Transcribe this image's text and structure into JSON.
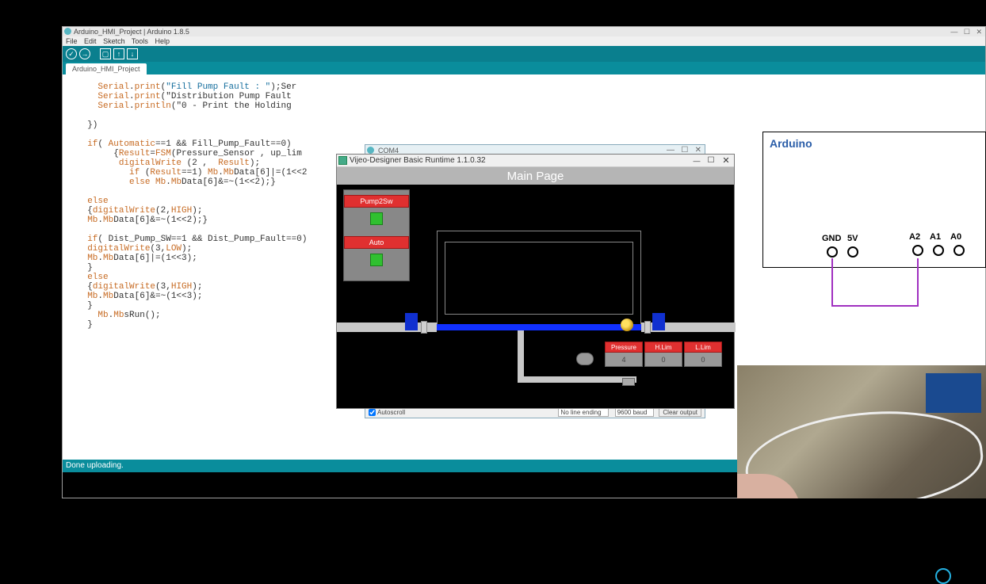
{
  "arduino_ide": {
    "title": "Arduino_HMI_Project | Arduino 1.8.5",
    "menu": [
      "File",
      "Edit",
      "Sketch",
      "Tools",
      "Help"
    ],
    "tab": "Arduino_HMI_Project",
    "status": "Done uploading.",
    "code_lines": [
      {
        "cls": "",
        "t": "    Serial.print(\"Fill Pump Fault : \");Ser"
      },
      {
        "cls": "",
        "t": "    Serial.print(\"Distribution Pump Fault"
      },
      {
        "cls": "",
        "t": "    Serial.println(\"0 - Print the Holding"
      },
      {
        "cls": "",
        "t": ""
      },
      {
        "cls": "",
        "t": "  })"
      },
      {
        "cls": "",
        "t": ""
      },
      {
        "cls": "",
        "t": "  if( Automatic==1 && Fill_Pump_Fault==0)"
      },
      {
        "cls": "",
        "t": "       {Result=FSM(Pressure_Sensor , up_lim"
      },
      {
        "cls": "",
        "t": "        digitalWrite (2 ,  Result);"
      },
      {
        "cls": "",
        "t": "          if (Result==1) Mb.MbData[6]|=(1<<2"
      },
      {
        "cls": "",
        "t": "          else Mb.MbData[6]&=~(1<<2);}"
      },
      {
        "cls": "",
        "t": ""
      },
      {
        "cls": "",
        "t": "  else"
      },
      {
        "cls": "",
        "t": "  {digitalWrite(2,HIGH);"
      },
      {
        "cls": "",
        "t": "  Mb.MbData[6]&=~(1<<2);}"
      },
      {
        "cls": "",
        "t": ""
      },
      {
        "cls": "",
        "t": "  if( Dist_Pump_SW==1 && Dist_Pump_Fault==0)"
      },
      {
        "cls": "",
        "t": "  digitalWrite(3,LOW);"
      },
      {
        "cls": "",
        "t": "  Mb.MbData[6]|=(1<<3);"
      },
      {
        "cls": "",
        "t": "  }"
      },
      {
        "cls": "",
        "t": "  else"
      },
      {
        "cls": "",
        "t": "  {digitalWrite(3,HIGH);"
      },
      {
        "cls": "",
        "t": "  Mb.MbData[6]&=~(1<<3);"
      },
      {
        "cls": "",
        "t": "  }"
      },
      {
        "cls": "",
        "t": "    Mb.MbsRun();"
      },
      {
        "cls": "",
        "t": "  }"
      }
    ]
  },
  "com_window": {
    "title": "COM4",
    "autoscroll": "Autoscroll",
    "line_ending": "No line ending",
    "baud": "9600 baud",
    "clear": "Clear output"
  },
  "hmi": {
    "title": "Vijeo-Designer Basic Runtime 1.1.0.32",
    "page_title": "Main Page",
    "btn_pump": "Pump2Sw",
    "btn_auto": "Auto",
    "pressure": {
      "lbl": "Pressure",
      "val": "4"
    },
    "hlim": {
      "lbl": "H.Lim",
      "val": "0"
    },
    "llim": {
      "lbl": "L.Lim",
      "val": "0"
    }
  },
  "schematic": {
    "label": "Arduino",
    "gnd": "GND",
    "v5": "5V",
    "a0": "A0",
    "a1": "A1",
    "a2": "A2"
  }
}
